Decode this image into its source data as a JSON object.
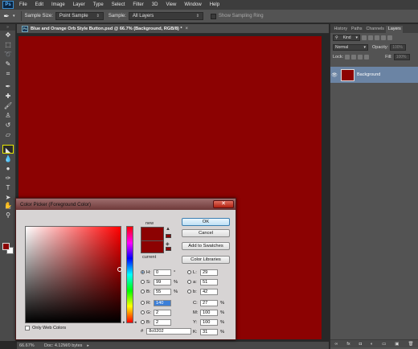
{
  "menu": {
    "logo": "Ps",
    "items": [
      "File",
      "Edit",
      "Image",
      "Layer",
      "Type",
      "Select",
      "Filter",
      "3D",
      "View",
      "Window",
      "Help"
    ]
  },
  "options": {
    "sample_size_label": "Sample Size:",
    "sample_size_value": "Point Sample",
    "sample_label": "Sample:",
    "sample_value": "All Layers",
    "show_ring_label": "Show Sampling Ring"
  },
  "document": {
    "tab_title": "Blue and Orange Orb Style Button.psd @ 66.7% (Background, RGB/8) *",
    "zoom": "66.67%",
    "doc_size": "Doc: 4.12M/0 bytes",
    "fill_color": "#8c0202"
  },
  "panel": {
    "tabs": [
      "History",
      "Paths",
      "Channels",
      "Layers"
    ],
    "active_tab": "Layers",
    "filter_kind": "Kind",
    "blend_mode": "Normal",
    "opacity_label": "Opacity:",
    "opacity_value": "100%",
    "lock_label": "Lock:",
    "fill_label": "Fill:",
    "fill_value": "100%",
    "layer_name": "Background",
    "bottom_icons": [
      "link-icon",
      "fx-icon",
      "mask-icon",
      "adjustment-icon",
      "folder-icon",
      "new-layer-icon",
      "trash-icon"
    ],
    "bottom_glyphs": [
      "∞",
      "fx",
      "◘",
      "◐",
      "▭",
      "▣",
      "🗑"
    ]
  },
  "dialog": {
    "title": "Color Picker (Foreground Color)",
    "close_glyph": "✕",
    "new_label": "new",
    "current_label": "current",
    "buttons": {
      "ok": "OK",
      "cancel": "Cancel",
      "add_to_swatches": "Add to Swatches",
      "color_libraries": "Color Libraries"
    },
    "hsb": [
      {
        "label": "H:",
        "value": "0",
        "unit": "°",
        "selected": true
      },
      {
        "label": "S:",
        "value": "99",
        "unit": "%",
        "selected": false
      },
      {
        "label": "B:",
        "value": "55",
        "unit": "%",
        "selected": false
      }
    ],
    "rgb": [
      {
        "label": "R:",
        "value": "140",
        "unit": "",
        "selected": false,
        "highlighted": true
      },
      {
        "label": "G:",
        "value": "2",
        "unit": "",
        "selected": false,
        "highlighted": false
      },
      {
        "label": "B:",
        "value": "2",
        "unit": "",
        "selected": false,
        "highlighted": false
      }
    ],
    "lab": [
      {
        "label": "L:",
        "value": "29"
      },
      {
        "label": "a:",
        "value": "51"
      },
      {
        "label": "b:",
        "value": "42"
      }
    ],
    "cmyk": [
      {
        "label": "C:",
        "value": "27",
        "unit": "%"
      },
      {
        "label": "M:",
        "value": "100",
        "unit": "%"
      },
      {
        "label": "Y:",
        "value": "100",
        "unit": "%"
      },
      {
        "label": "K:",
        "value": "31",
        "unit": "%"
      }
    ],
    "hex_label": "#",
    "hex_value": "8c0202",
    "web_colors_label": "Only Web Colors",
    "color": "#8c0202"
  },
  "tools": [
    {
      "name": "move-tool-icon",
      "glyph": "✥"
    },
    {
      "name": "marquee-tool-icon",
      "glyph": "⬚"
    },
    {
      "name": "lasso-tool-icon",
      "glyph": "➰"
    },
    {
      "name": "quick-select-tool-icon",
      "glyph": "✎"
    },
    {
      "name": "crop-tool-icon",
      "glyph": "⌗"
    },
    {
      "name": "eyedropper-tool-icon",
      "glyph": "✒"
    },
    {
      "name": "healing-tool-icon",
      "glyph": "✚"
    },
    {
      "name": "brush-tool-icon",
      "glyph": "🖌"
    },
    {
      "name": "clone-stamp-tool-icon",
      "glyph": "♙"
    },
    {
      "name": "history-brush-tool-icon",
      "glyph": "↺"
    },
    {
      "name": "eraser-tool-icon",
      "glyph": "▱"
    },
    {
      "name": "paint-bucket-tool-icon",
      "glyph": "◣",
      "active": true
    },
    {
      "name": "blur-tool-icon",
      "glyph": "💧"
    },
    {
      "name": "dodge-tool-icon",
      "glyph": "●"
    },
    {
      "name": "pen-tool-icon",
      "glyph": "✑"
    },
    {
      "name": "type-tool-icon",
      "glyph": "T"
    },
    {
      "name": "path-select-tool-icon",
      "glyph": "➤"
    },
    {
      "name": "shape-tool-icon",
      "glyph": "▭"
    },
    {
      "name": "hand-tool-icon",
      "glyph": "✋"
    },
    {
      "name": "zoom-tool-icon",
      "glyph": "⚲"
    }
  ]
}
